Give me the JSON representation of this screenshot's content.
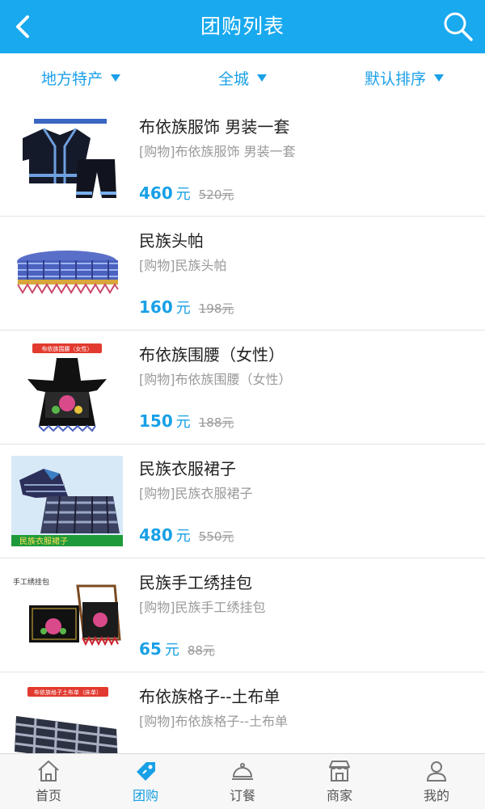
{
  "header": {
    "title": "团购列表"
  },
  "filters": [
    {
      "label": "地方特产"
    },
    {
      "label": "全城"
    },
    {
      "label": "默认排序"
    }
  ],
  "items": [
    {
      "name": "布依族服饰 男装一套",
      "desc": "[购物]布依族服饰 男装一套",
      "price": "460",
      "unit": "元",
      "orig": "520元",
      "banner": ""
    },
    {
      "name": "民族头帕",
      "desc": "[购物]民族头帕",
      "price": "160",
      "unit": "元",
      "orig": "198元",
      "banner": ""
    },
    {
      "name": "布依族围腰（女性）",
      "desc": "[购物]布依族围腰（女性）",
      "price": "150",
      "unit": "元",
      "orig": "188元",
      "banner": "布依族围腰（女性）"
    },
    {
      "name": "民族衣服裙子",
      "desc": "[购物]民族衣服裙子",
      "price": "480",
      "unit": "元",
      "orig": "550元",
      "banner": "民族衣服裙子"
    },
    {
      "name": "民族手工绣挂包",
      "desc": "[购物]民族手工绣挂包",
      "price": "65",
      "unit": "元",
      "orig": "88元",
      "banner": "手工绣挂包"
    },
    {
      "name": "布依族格子--土布单",
      "desc": "[购物]布依族格子--土布单",
      "price": "",
      "unit": "",
      "orig": "",
      "banner": "布依族格子土布单（床单）"
    }
  ],
  "tabs": [
    {
      "label": "首页",
      "icon": "home-icon"
    },
    {
      "label": "团购",
      "icon": "tag-icon",
      "active": true
    },
    {
      "label": "订餐",
      "icon": "dining-bell-icon"
    },
    {
      "label": "商家",
      "icon": "store-icon"
    },
    {
      "label": "我的",
      "icon": "user-icon"
    }
  ],
  "colors": {
    "accent": "#18a9ee",
    "price": "#18a0e6",
    "muted": "#9a9a9a"
  }
}
